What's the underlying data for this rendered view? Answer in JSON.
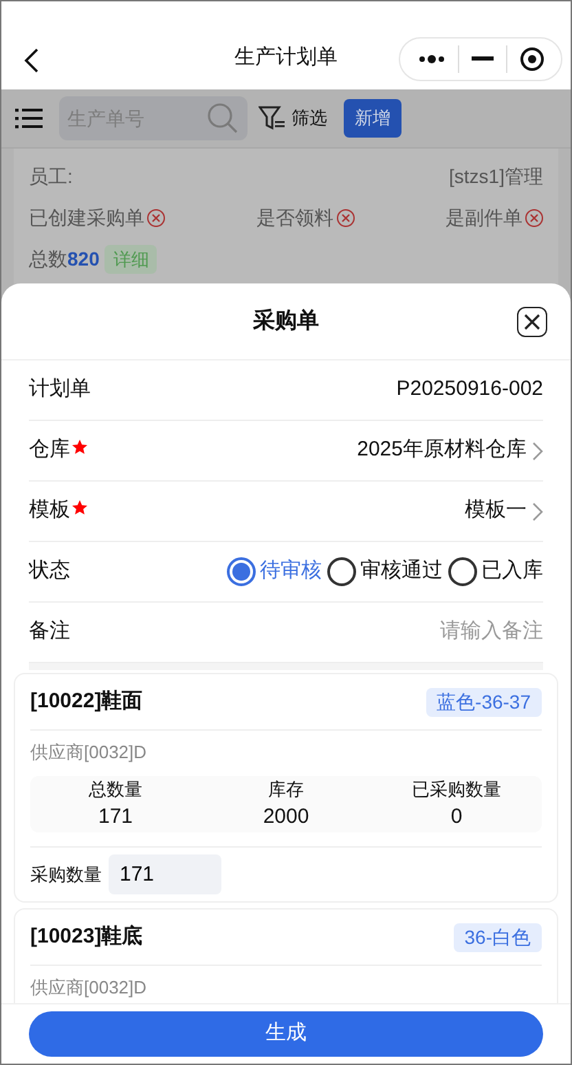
{
  "nav": {
    "title": "生产计划单"
  },
  "toolbar": {
    "search": {
      "placeholder": "生产单号"
    },
    "filter_label": "筛选",
    "add_button": "新增"
  },
  "summary": {
    "employee_label": "员工:",
    "employee_value": "[stzs1]管理",
    "flags": [
      {
        "label": "已创建采购单",
        "on": false
      },
      {
        "label": "是否领料",
        "on": false
      },
      {
        "label": "是副件单",
        "on": false
      }
    ],
    "total_label": "总数",
    "total_value": "820",
    "detail_button": "详细"
  },
  "sheet": {
    "title": "采购单",
    "fields": [
      {
        "kind": "text",
        "label": "计划单",
        "required": false,
        "value": "P20250916-002"
      },
      {
        "kind": "select",
        "label": "仓库",
        "required": true,
        "value": "2025年原材料仓库"
      },
      {
        "kind": "select",
        "label": "模板",
        "required": true,
        "value": "模板一"
      },
      {
        "kind": "radio",
        "label": "状态",
        "required": false,
        "options": [
          {
            "label": "待审核",
            "selected": true
          },
          {
            "label": "审核通过",
            "selected": false
          },
          {
            "label": "已入库",
            "selected": false
          }
        ]
      },
      {
        "kind": "input",
        "label": "备注",
        "required": false,
        "placeholder": "请输入备注"
      }
    ],
    "items": [
      {
        "name": "[10022]鞋面",
        "tag": "蓝色-36-37",
        "supplier": "供应商[0032]D",
        "stats": [
          {
            "label": "总数量",
            "value": "171"
          },
          {
            "label": "库存",
            "value": "2000"
          },
          {
            "label": "已采购数量",
            "value": "0"
          }
        ],
        "qty_label": "采购数量",
        "qty_value": "171"
      },
      {
        "name": "[10023]鞋底",
        "tag": "36-白色",
        "supplier": "供应商[0032]D"
      }
    ],
    "submit_button": "生成"
  }
}
